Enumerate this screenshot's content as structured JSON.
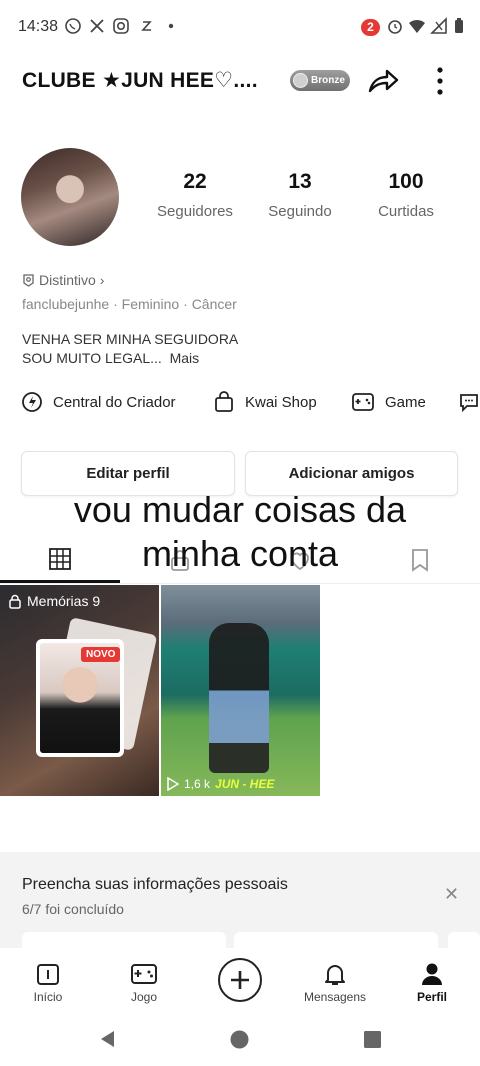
{
  "status_bar": {
    "time": "14:38",
    "notification_count": "2",
    "icons": [
      "whatsapp-icon",
      "pinwheel-icon",
      "instagram-icon",
      "app-icon",
      "dot-icon",
      "alarm-icon",
      "wifi-icon",
      "signal-icon",
      "battery-icon"
    ]
  },
  "header": {
    "title": "CLUBE ★JUN HEE♡....",
    "badge_label": "Bronze",
    "share_icon": "share-arrow-icon",
    "more_icon": "more-vertical-icon"
  },
  "profile": {
    "stats": [
      {
        "value": "22",
        "label": "Seguidores"
      },
      {
        "value": "13",
        "label": "Seguindo"
      },
      {
        "value": "100",
        "label": "Curtidas"
      }
    ],
    "distintivo": "Distintivo",
    "handle": "fanclubejunhe",
    "gender": "Feminino",
    "sign": "Câncer",
    "bio_line1": "VENHA SER MINHA SEGUIDORA",
    "bio_line2": "SOU MUITO LEGAL...",
    "bio_more": "Mais"
  },
  "shortcuts": [
    {
      "label": "Central do Criador",
      "icon": "creator-center-icon"
    },
    {
      "label": "Kwai Shop",
      "icon": "shopping-bag-icon"
    },
    {
      "label": "Game",
      "icon": "gamepad-icon"
    }
  ],
  "actions": {
    "edit_profile": "Editar perfil",
    "add_friends": "Adicionar amigos"
  },
  "overlay_caption": {
    "line1": "vou mudar coisas da",
    "line2": "minha conta"
  },
  "tabs": [
    "grid-icon",
    "lock-icon",
    "heart-icon",
    "bookmark-icon"
  ],
  "grid": {
    "memories_label": "Memórias 9",
    "new_badge": "NOVO",
    "video_views": "1,6 k",
    "video_overlay_text": "JUN - HEE"
  },
  "info_card": {
    "title": "Preencha suas informações pessoais",
    "progress_text": "6/7 foi concluído",
    "progress_fraction": 0.857
  },
  "bottom_nav": [
    {
      "label": "Início",
      "icon": "home-icon"
    },
    {
      "label": "Jogo",
      "icon": "game-icon"
    },
    {
      "label": "",
      "icon": "plus-icon"
    },
    {
      "label": "Mensagens",
      "icon": "bell-icon"
    },
    {
      "label": "Perfil",
      "icon": "person-icon"
    }
  ],
  "colors": {
    "badge_red": "#e53935",
    "bronze": "#808080",
    "text_primary": "#111111",
    "text_secondary": "#666666"
  }
}
